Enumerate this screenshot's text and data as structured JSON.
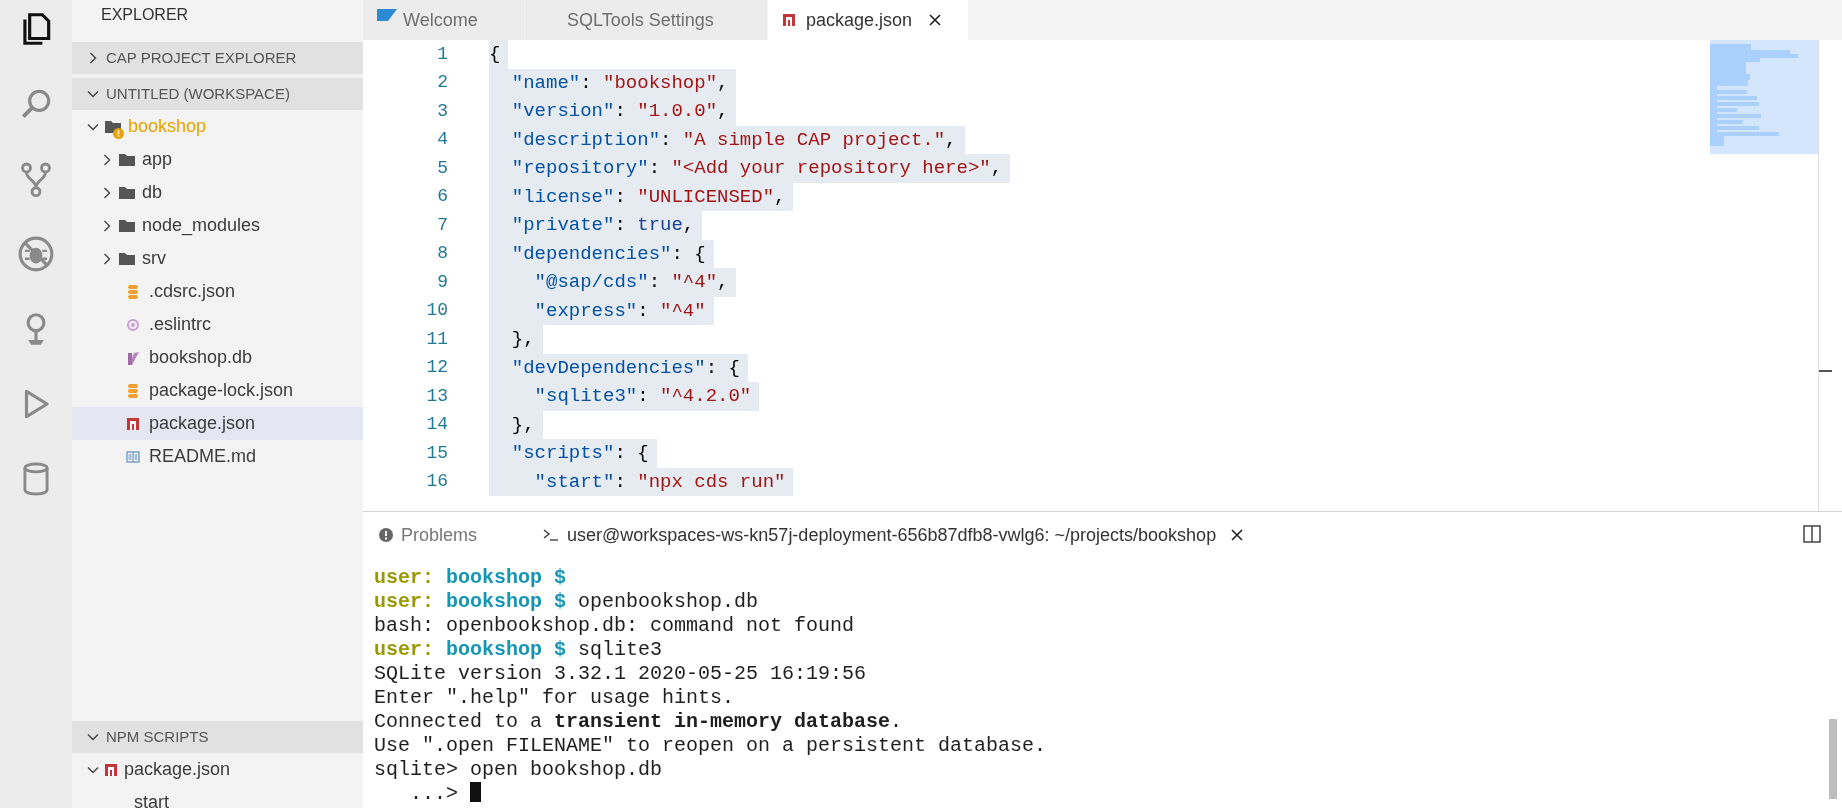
{
  "activity_bar": [
    {
      "selected": true
    },
    {
      "selected": false
    },
    {
      "selected": false
    },
    {
      "selected": false
    },
    {
      "selected": false
    },
    {
      "selected": false
    },
    {
      "selected": false
    }
  ],
  "sidebar": {
    "title": "EXPLORER",
    "sections": [
      {
        "title": "CAP PROJECT EXPLORER",
        "expanded": false
      },
      {
        "title": "UNTITLED (WORKSPACE)",
        "expanded": true,
        "tree": [
          {
            "name": "bookshop",
            "kind": "folder",
            "expanded": true,
            "warning": true,
            "selected": false,
            "children": [
              {
                "name": "app",
                "kind": "folder",
                "expanded": false,
                "selected": false
              },
              {
                "name": "db",
                "kind": "folder",
                "expanded": false,
                "selected": false
              },
              {
                "name": "node_modules",
                "kind": "folder",
                "expanded": false,
                "selected": false
              },
              {
                "name": "srv",
                "kind": "folder",
                "expanded": false,
                "selected": false
              },
              {
                "name": ".cdsrc.json",
                "kind": "config",
                "selected": false
              },
              {
                "name": ".eslintrc",
                "kind": "eslint",
                "selected": false
              },
              {
                "name": "bookshop.db",
                "kind": "database",
                "selected": false
              },
              {
                "name": "package-lock.json",
                "kind": "config",
                "selected": false
              },
              {
                "name": "package.json",
                "kind": "npm",
                "selected": true
              },
              {
                "name": "README.md",
                "kind": "markdown",
                "selected": false
              }
            ]
          }
        ]
      },
      {
        "title": "NPM SCRIPTS",
        "expanded": true,
        "tree": [
          {
            "name": "package.json",
            "kind": "npm",
            "expanded": true,
            "selected": false,
            "children": [
              {
                "name": "start",
                "kind": "script",
                "selected": false
              }
            ]
          }
        ]
      }
    ]
  },
  "editor": {
    "tabs": [
      {
        "label": "Welcome",
        "selected": false
      },
      {
        "label": "SQLTools Settings",
        "selected": false
      },
      {
        "label": "package.json",
        "selected": true
      }
    ],
    "lines": [
      {
        "number": "1",
        "selected": true,
        "tokens": [
          {
            "kind": "punct",
            "text": "{"
          }
        ]
      },
      {
        "number": "2",
        "selected": true,
        "tokens": [
          {
            "kind": "key",
            "text": "  \"name\""
          },
          {
            "kind": "punct",
            "text": ": "
          },
          {
            "kind": "string",
            "text": "\"bookshop\""
          },
          {
            "kind": "punct",
            "text": ","
          }
        ]
      },
      {
        "number": "3",
        "selected": true,
        "tokens": [
          {
            "kind": "key",
            "text": "  \"version\""
          },
          {
            "kind": "punct",
            "text": ": "
          },
          {
            "kind": "string",
            "text": "\"1.0.0\""
          },
          {
            "kind": "punct",
            "text": ","
          }
        ]
      },
      {
        "number": "4",
        "selected": true,
        "tokens": [
          {
            "kind": "key",
            "text": "  \"description\""
          },
          {
            "kind": "punct",
            "text": ": "
          },
          {
            "kind": "string",
            "text": "\"A simple CAP project.\""
          },
          {
            "kind": "punct",
            "text": ","
          }
        ]
      },
      {
        "number": "5",
        "selected": true,
        "tokens": [
          {
            "kind": "key",
            "text": "  \"repository\""
          },
          {
            "kind": "punct",
            "text": ": "
          },
          {
            "kind": "string",
            "text": "\"<Add your repository here>\""
          },
          {
            "kind": "punct",
            "text": ","
          }
        ]
      },
      {
        "number": "6",
        "selected": true,
        "tokens": [
          {
            "kind": "key",
            "text": "  \"license\""
          },
          {
            "kind": "punct",
            "text": ": "
          },
          {
            "kind": "string",
            "text": "\"UNLICENSED\""
          },
          {
            "kind": "punct",
            "text": ","
          }
        ]
      },
      {
        "number": "7",
        "selected": true,
        "tokens": [
          {
            "kind": "key",
            "text": "  \"private\""
          },
          {
            "kind": "punct",
            "text": ": "
          },
          {
            "kind": "keyword",
            "text": "true"
          },
          {
            "kind": "punct",
            "text": ","
          }
        ]
      },
      {
        "number": "8",
        "selected": true,
        "tokens": [
          {
            "kind": "key",
            "text": "  \"dependencies\""
          },
          {
            "kind": "punct",
            "text": ": {"
          }
        ]
      },
      {
        "number": "9",
        "selected": true,
        "tokens": [
          {
            "kind": "key",
            "text": "    \"@sap/cds\""
          },
          {
            "kind": "punct",
            "text": ": "
          },
          {
            "kind": "string",
            "text": "\"^4\""
          },
          {
            "kind": "punct",
            "text": ","
          }
        ]
      },
      {
        "number": "10",
        "selected": true,
        "tokens": [
          {
            "kind": "key",
            "text": "    \"express\""
          },
          {
            "kind": "punct",
            "text": ": "
          },
          {
            "kind": "string",
            "text": "\"^4\""
          }
        ]
      },
      {
        "number": "11",
        "selected": true,
        "tokens": [
          {
            "kind": "punct",
            "text": "  },"
          }
        ]
      },
      {
        "number": "12",
        "selected": true,
        "tokens": [
          {
            "kind": "key",
            "text": "  \"devDependencies\""
          },
          {
            "kind": "punct",
            "text": ": {"
          }
        ]
      },
      {
        "number": "13",
        "selected": true,
        "tokens": [
          {
            "kind": "key",
            "text": "    \"sqlite3\""
          },
          {
            "kind": "punct",
            "text": ": "
          },
          {
            "kind": "string",
            "text": "\"^4.2.0\""
          }
        ]
      },
      {
        "number": "14",
        "selected": true,
        "tokens": [
          {
            "kind": "punct",
            "text": "  },"
          }
        ]
      },
      {
        "number": "15",
        "selected": true,
        "tokens": [
          {
            "kind": "key",
            "text": "  \"scripts\""
          },
          {
            "kind": "punct",
            "text": ": {"
          }
        ]
      },
      {
        "number": "16",
        "selected": true,
        "tokens": [
          {
            "kind": "key",
            "text": "    \"start\""
          },
          {
            "kind": "punct",
            "text": ": "
          },
          {
            "kind": "string",
            "text": "\"npx cds run\""
          }
        ]
      }
    ]
  },
  "panel": {
    "tabs": [
      {
        "label": "Problems",
        "selected": false
      },
      {
        "label": "user@workspaces-ws-kn57j-deployment-656b87dfb8-vwlg6: ~/projects/bookshop",
        "selected": true
      }
    ],
    "terminal": {
      "cursor": true,
      "lines": [
        [
          {
            "kind": "user",
            "text": "user:"
          },
          {
            "kind": "path",
            "text": " bookshop $"
          }
        ],
        [
          {
            "kind": "user",
            "text": "user:"
          },
          {
            "kind": "path",
            "text": " bookshop $"
          },
          {
            "kind": "text",
            "text": " openbookshop.db"
          }
        ],
        [
          {
            "kind": "text",
            "text": "bash: openbookshop.db: command not found"
          }
        ],
        [
          {
            "kind": "user",
            "text": "user:"
          },
          {
            "kind": "path",
            "text": " bookshop $"
          },
          {
            "kind": "text",
            "text": " sqlite3"
          }
        ],
        [
          {
            "kind": "text",
            "text": "SQLite version 3.32.1 2020-05-25 16:19:56"
          }
        ],
        [
          {
            "kind": "text",
            "text": "Enter \".help\" for usage hints."
          }
        ],
        [
          {
            "kind": "text",
            "text": "Connected to a **transient in-memory database**."
          }
        ],
        [
          {
            "kind": "text",
            "text": "Use \".open FILENAME\" to reopen on a persistent database."
          }
        ],
        [
          {
            "kind": "text",
            "text": "sqlite> open bookshop.db"
          }
        ],
        [
          {
            "kind": "text",
            "text": "   ...>"
          }
        ]
      ]
    }
  }
}
